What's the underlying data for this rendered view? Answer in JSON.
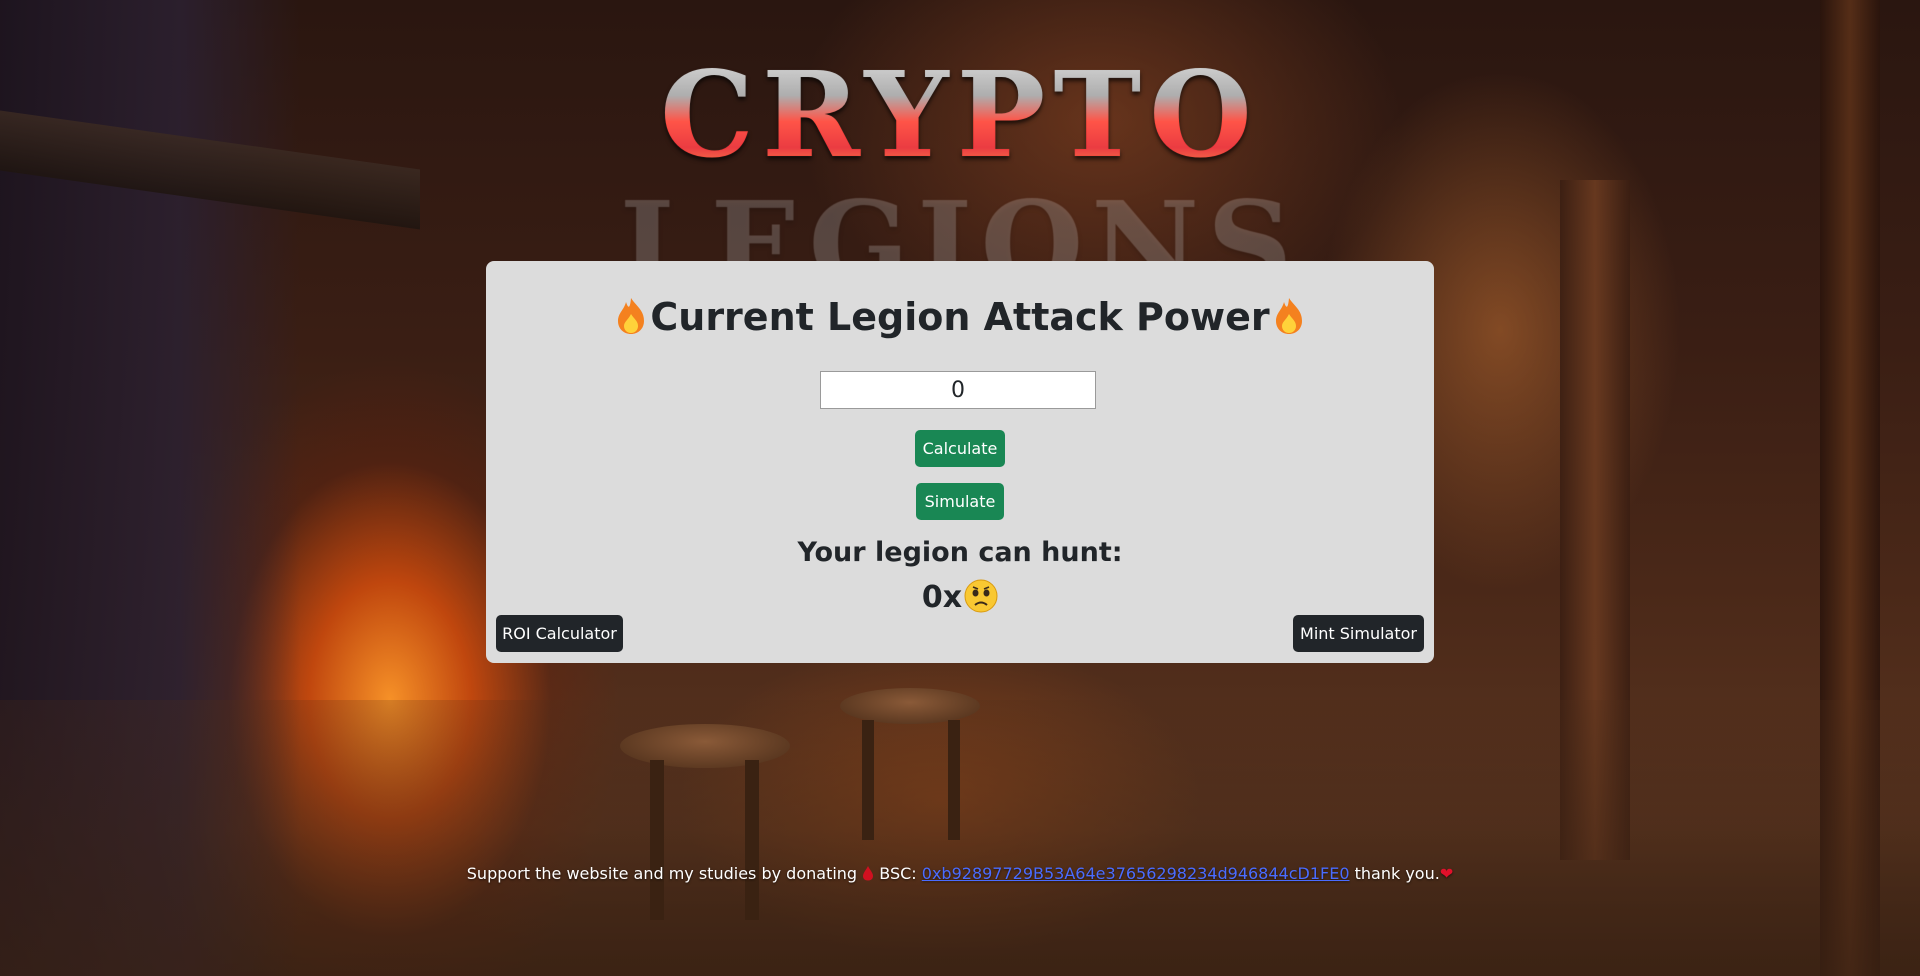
{
  "logo": {
    "text": "CRYPTO LEGIONS"
  },
  "card": {
    "title": "Current Legion Attack Power",
    "title_icons": [
      "fire-icon",
      "fire-icon"
    ],
    "power_input_value": "0",
    "calculate_label": "Calculate",
    "simulate_label": "Simulate",
    "hunt_label": "Your legion can hunt:",
    "hunt_value": "0x",
    "hunt_icon": "sad-face-icon",
    "roi_button_label": "ROI Calculator",
    "mint_button_label": "Mint Simulator"
  },
  "footer": {
    "text_before": "Support the website and my studies by donating",
    "drop_icon": "blood-drop-icon",
    "bsc_label": "BSC:",
    "address": "0xb92897729B53A64e37656298234d946844cD1FE0",
    "text_after": "thank you.",
    "heart": "❤"
  },
  "colors": {
    "card_bg": "#dcdcdc",
    "green_button": "#198754",
    "dark_button": "#212529",
    "link": "#4a6cff",
    "logo_red": "#e8101a"
  }
}
